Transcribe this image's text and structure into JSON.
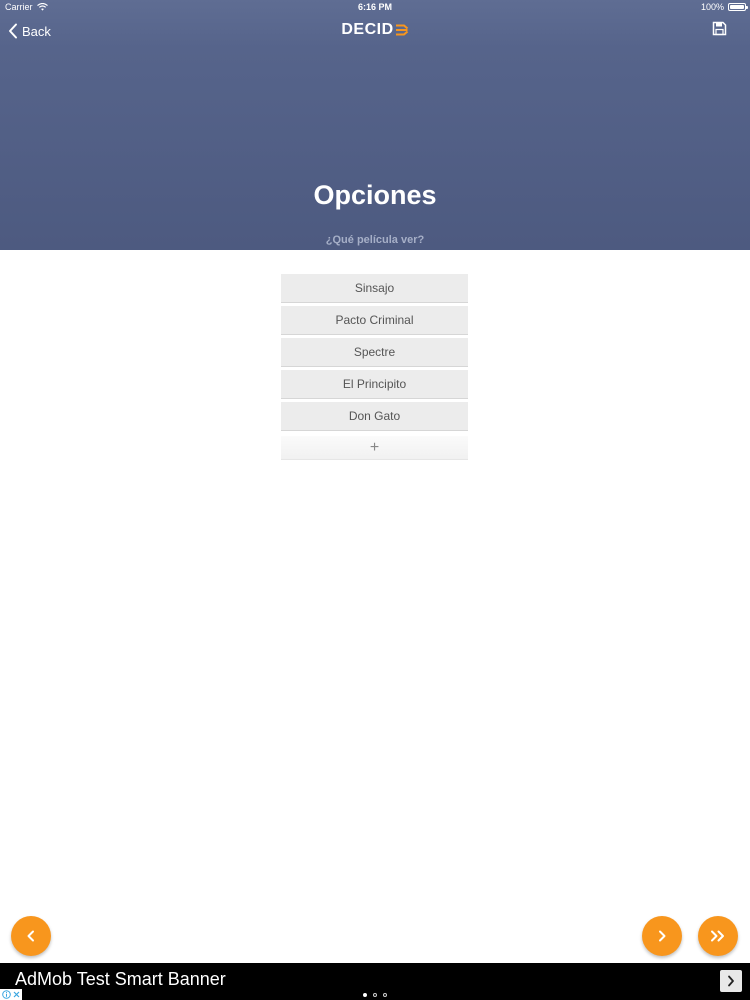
{
  "status_bar": {
    "carrier": "Carrier",
    "time": "6:16 PM",
    "battery": "100%"
  },
  "nav": {
    "back_label": "Back",
    "logo_text": "DECID",
    "logo_accent_color": "#f8961d",
    "save_icon": "save-icon"
  },
  "header": {
    "title": "Opciones",
    "subtitle": "¿Qué película ver?"
  },
  "options": [
    {
      "label": "Sinsajo"
    },
    {
      "label": "Pacto Criminal"
    },
    {
      "label": "Spectre"
    },
    {
      "label": "El Principito"
    },
    {
      "label": "Don Gato"
    }
  ],
  "add_option_label": "+",
  "controls": {
    "accent_color": "#f8961d",
    "prev_icon": "chevron-left-icon",
    "next_icon": "chevron-right-icon",
    "last_icon": "double-chevron-right-icon"
  },
  "ad": {
    "text": "AdMob Test Smart Banner"
  },
  "pagination": {
    "total": 3,
    "current": 1
  },
  "colors": {
    "header_bg": "#4d5a80",
    "option_bg": "#ececec",
    "ad_bg": "#000000"
  }
}
